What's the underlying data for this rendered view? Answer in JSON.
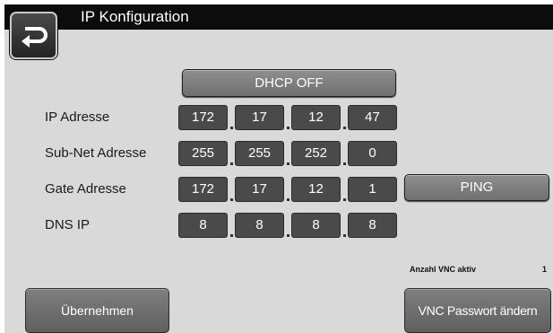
{
  "header": {
    "title": "IP Konfiguration",
    "back_icon": "return-arrow-icon"
  },
  "dhcp": {
    "label": "DHCP OFF"
  },
  "rows": [
    {
      "label": "IP Adresse",
      "octets": [
        "172",
        "17",
        "12",
        "47"
      ]
    },
    {
      "label": "Sub-Net Adresse",
      "octets": [
        "255",
        "255",
        "252",
        "0"
      ]
    },
    {
      "label": "Gate Adresse",
      "octets": [
        "172",
        "17",
        "12",
        "1"
      ]
    },
    {
      "label": "DNS IP",
      "octets": [
        "8",
        "8",
        "8",
        "8"
      ]
    }
  ],
  "ping": {
    "label": "PING"
  },
  "vnc": {
    "label": "Anzahl VNC aktiv",
    "count": "1"
  },
  "footer": {
    "apply_label": "Übernehmen",
    "vnc_password_label": "VNC Passwort ändern"
  },
  "colors": {
    "title_bar": "#0c0c0c",
    "background": "#d9d9d9",
    "field": "#4a4a4a",
    "button": "#7f7f7f"
  }
}
